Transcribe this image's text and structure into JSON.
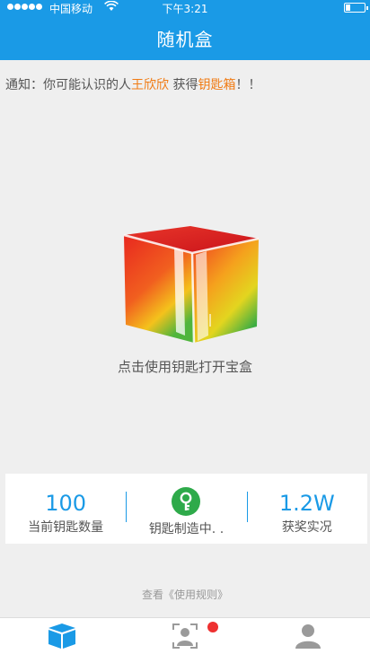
{
  "status_bar": {
    "carrier": "中国移动",
    "time": "下午3:21"
  },
  "nav": {
    "title": "随机盒"
  },
  "notice": {
    "prefix": "通知：你可能认识的人",
    "user_name": "王欣欣",
    "middle": " 获得",
    "item_name": "钥匙箱",
    "suffix": "！！"
  },
  "box": {
    "hint": "点击使用钥匙打开宝盒"
  },
  "stats": {
    "key_count": {
      "value": "100",
      "label": "当前钥匙数量"
    },
    "making": {
      "label": "钥匙制造中. ."
    },
    "rewards": {
      "value": "1.2W",
      "label": "获奖实况"
    }
  },
  "rules_link": "查看《使用规则》",
  "tabs": [
    {
      "icon": "box-icon",
      "active": true
    },
    {
      "icon": "scan-face-icon",
      "active": false,
      "badge": true
    },
    {
      "icon": "person-icon",
      "active": false
    }
  ],
  "colors": {
    "primary": "#1a9ae6",
    "highlight": "#f07b13",
    "key_green": "#2eaa4a",
    "badge_red": "#ee3030"
  }
}
